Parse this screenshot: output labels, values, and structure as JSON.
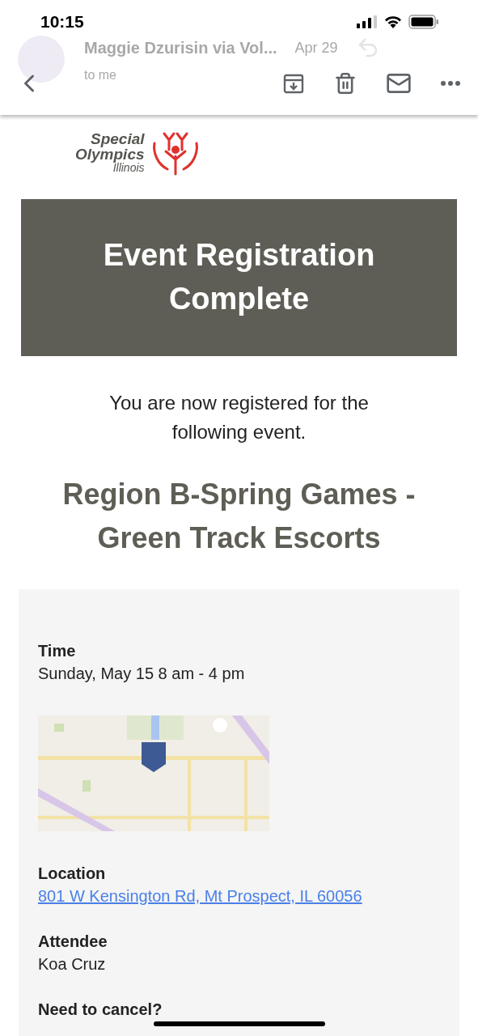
{
  "status_bar": {
    "time": "10:15"
  },
  "message_header": {
    "sender": "Maggie Dzurisin via Vol...",
    "date": "Apr 29",
    "recipient": "to me"
  },
  "logo": {
    "line_1": "Special",
    "line_2": "Olympics",
    "line_3": "Illinois"
  },
  "banner": {
    "title": "Event Registration Complete"
  },
  "intro": "You are now registered for the following event.",
  "event_title": "Region B-Spring Games - Green Track Escorts",
  "details": [
    {
      "kind": "text",
      "label": "Time",
      "value": "Sunday, May 15 8 am - 4 pm"
    },
    {
      "kind": "picture"
    },
    {
      "kind": "link",
      "label": "Location",
      "value": "801 W Kensington Rd, Mt Prospect, IL 60056"
    },
    {
      "kind": "text",
      "label": "Attendee",
      "value": "Koa Cruz"
    },
    {
      "kind": "heading",
      "label": "Need to cancel?"
    }
  ]
}
